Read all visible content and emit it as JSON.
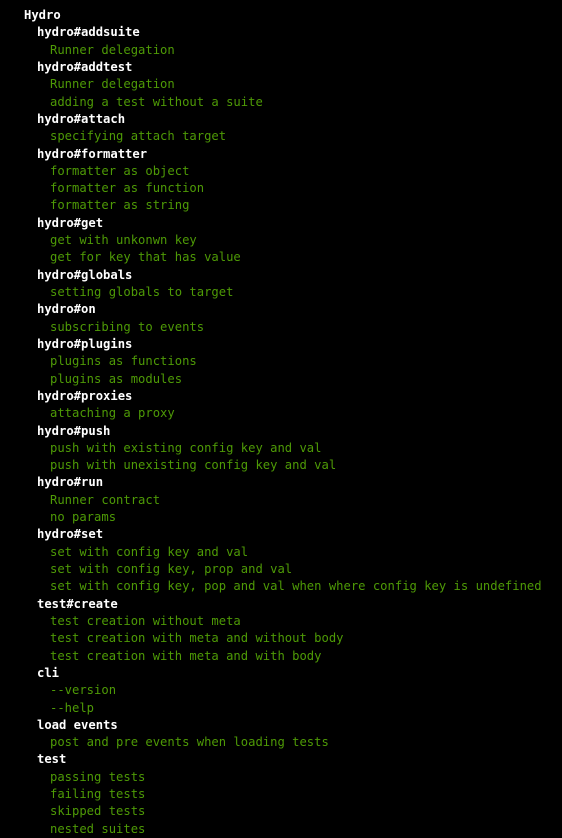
{
  "terminal": {
    "background_color": "#000000",
    "suite_color": "#ffffff",
    "test_color": "#4e9a06",
    "lines": [
      {
        "text": "Hydro",
        "kind": "suite",
        "depth": 0
      },
      {
        "text": "hydro#addsuite",
        "kind": "suite",
        "depth": 1
      },
      {
        "text": "Runner delegation",
        "kind": "test",
        "depth": 2
      },
      {
        "text": "hydro#addtest",
        "kind": "suite",
        "depth": 1
      },
      {
        "text": "Runner delegation",
        "kind": "test",
        "depth": 2
      },
      {
        "text": "adding a test without a suite",
        "kind": "test",
        "depth": 2
      },
      {
        "text": "hydro#attach",
        "kind": "suite",
        "depth": 1
      },
      {
        "text": "specifying attach target",
        "kind": "test",
        "depth": 2
      },
      {
        "text": "hydro#formatter",
        "kind": "suite",
        "depth": 1
      },
      {
        "text": "formatter as object",
        "kind": "test",
        "depth": 2
      },
      {
        "text": "formatter as function",
        "kind": "test",
        "depth": 2
      },
      {
        "text": "formatter as string",
        "kind": "test",
        "depth": 2
      },
      {
        "text": "hydro#get",
        "kind": "suite",
        "depth": 1
      },
      {
        "text": "get with unkonwn key",
        "kind": "test",
        "depth": 2
      },
      {
        "text": "get for key that has value",
        "kind": "test",
        "depth": 2
      },
      {
        "text": "hydro#globals",
        "kind": "suite",
        "depth": 1
      },
      {
        "text": "setting globals to target",
        "kind": "test",
        "depth": 2
      },
      {
        "text": "hydro#on",
        "kind": "suite",
        "depth": 1
      },
      {
        "text": "subscribing to events",
        "kind": "test",
        "depth": 2
      },
      {
        "text": "hydro#plugins",
        "kind": "suite",
        "depth": 1
      },
      {
        "text": "plugins as functions",
        "kind": "test",
        "depth": 2
      },
      {
        "text": "plugins as modules",
        "kind": "test",
        "depth": 2
      },
      {
        "text": "hydro#proxies",
        "kind": "suite",
        "depth": 1
      },
      {
        "text": "attaching a proxy",
        "kind": "test",
        "depth": 2
      },
      {
        "text": "hydro#push",
        "kind": "suite",
        "depth": 1
      },
      {
        "text": "push with existing config key and val",
        "kind": "test",
        "depth": 2
      },
      {
        "text": "push with unexisting config key and val",
        "kind": "test",
        "depth": 2
      },
      {
        "text": "hydro#run",
        "kind": "suite",
        "depth": 1
      },
      {
        "text": "Runner contract",
        "kind": "test",
        "depth": 2
      },
      {
        "text": "no params",
        "kind": "test",
        "depth": 2
      },
      {
        "text": "hydro#set",
        "kind": "suite",
        "depth": 1
      },
      {
        "text": "set with config key and val",
        "kind": "test",
        "depth": 2
      },
      {
        "text": "set with config key, prop and val",
        "kind": "test",
        "depth": 2
      },
      {
        "text": "set with config key, pop and val when where config key is undefined",
        "kind": "test",
        "depth": 2
      },
      {
        "text": "test#create",
        "kind": "suite",
        "depth": 1
      },
      {
        "text": "test creation without meta",
        "kind": "test",
        "depth": 2
      },
      {
        "text": "test creation with meta and without body",
        "kind": "test",
        "depth": 2
      },
      {
        "text": "test creation with meta and with body",
        "kind": "test",
        "depth": 2
      },
      {
        "text": "cli",
        "kind": "suite",
        "depth": 1
      },
      {
        "text": "--version",
        "kind": "test",
        "depth": 2
      },
      {
        "text": "--help",
        "kind": "test",
        "depth": 2
      },
      {
        "text": "load events",
        "kind": "suite",
        "depth": 1
      },
      {
        "text": "post and pre events when loading tests",
        "kind": "test",
        "depth": 2
      },
      {
        "text": "test",
        "kind": "suite",
        "depth": 1
      },
      {
        "text": "passing tests",
        "kind": "test",
        "depth": 2
      },
      {
        "text": "failing tests",
        "kind": "test",
        "depth": 2
      },
      {
        "text": "skipped tests",
        "kind": "test",
        "depth": 2
      },
      {
        "text": "nested suites",
        "kind": "test",
        "depth": 2
      }
    ]
  }
}
